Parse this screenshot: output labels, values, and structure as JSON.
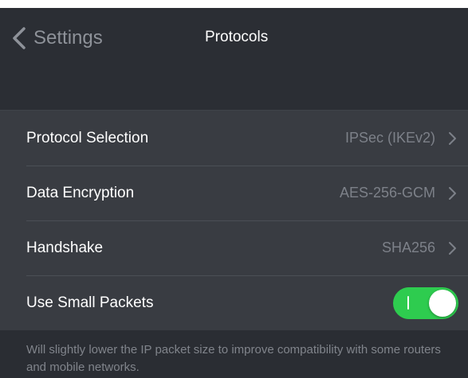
{
  "nav": {
    "back_label": "Settings",
    "title": "Protocols"
  },
  "rows": [
    {
      "label": "Protocol Selection",
      "value": "IPSec (IKEv2)"
    },
    {
      "label": "Data Encryption",
      "value": "AES-256-GCM"
    },
    {
      "label": "Handshake",
      "value": "SHA256"
    },
    {
      "label": "Use Small Packets",
      "toggle_on": true
    }
  ],
  "footnote": "Will slightly lower the IP packet size to improve compatibility with some routers and mobile networks.",
  "colors": {
    "background": "#2a2d33",
    "list_background": "#393c42",
    "toggle_on": "#2ecc4f",
    "secondary_text": "#7d8189"
  }
}
